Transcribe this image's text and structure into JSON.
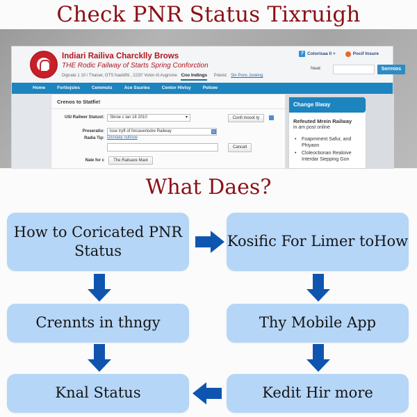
{
  "header": {
    "title": "Check PNR Status Tixruigh"
  },
  "site": {
    "name": "Indiari Railiva Charcklly Brows",
    "tagline": "THE Rodic Failway of Starts Spring Conforction",
    "crumbs": {
      "path": "Dignate 1 10 / Thaiser, OTS foadd0ti , 2220' Volon Al Augrome",
      "active": "Cno Indings",
      "label": "Poleist:",
      "link": "Sin Pons Jooking"
    },
    "top_links": {
      "help": "Colorisaa ll +",
      "post": "Pocif Insure"
    },
    "search": {
      "label": "Neat:",
      "value": "",
      "button": "Serrnios"
    },
    "nav": [
      "Home",
      "Fortiojsles",
      "Cemmuts",
      "Ace Ssuries",
      "Centor Hivlsy",
      "Potiow"
    ]
  },
  "form": {
    "title": "Crenos to Statfie!",
    "status_label": "USI Railwer Statust:",
    "status_value": "Sbroe c lan 18 2010",
    "confirm_button": "Confi mosot ty",
    "preservation_label": "Preseratio:",
    "preservation_value": "lose tryft of forcaverlodre Railway",
    "radio_label": "Radia Tip:",
    "radio_link": "Disnsiey nuh/uw",
    "extra_value": "",
    "cancel_button": "Cancall",
    "note_label": "Nale for c",
    "note_button": "The Raituare Maot"
  },
  "sidebar": {
    "heading": "Change Iliway",
    "subheading": "Refeuted Mrein Railway",
    "subtext": "in am post online",
    "items": [
      "Foapmment Safur, and Phiyaon",
      "Cloleoctionan Realoive Interdar Siepping Gon"
    ]
  },
  "flow": {
    "title": "What Daes?",
    "boxes": [
      "How to Coricated PNR Status",
      "Kosific For Limer toHow",
      "Crennts in thngy",
      "Thy Mobile App",
      "Knal Status",
      "Kedit Hir more"
    ]
  },
  "colors": {
    "title": "#8b1016",
    "box": "#b5d6f7",
    "arrow": "#0f55b0",
    "nav": "#1c84bf"
  }
}
